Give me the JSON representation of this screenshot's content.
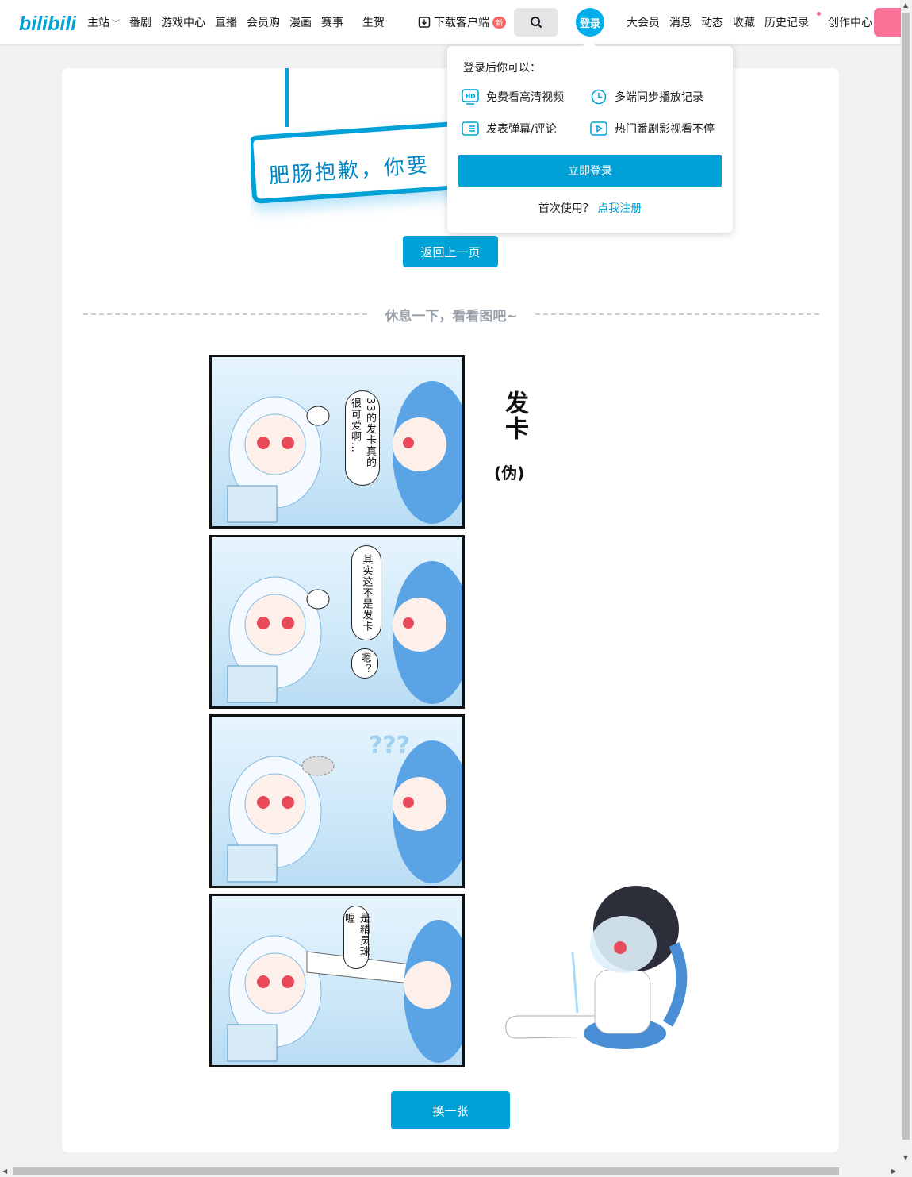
{
  "header": {
    "nav": [
      "主站",
      "番剧",
      "游戏中心",
      "直播",
      "会员购",
      "漫画",
      "赛事",
      "生贺"
    ],
    "download": "下载客户端",
    "download_badge": "新",
    "login": "登录",
    "right_nav": [
      "大会员",
      "消息",
      "动态",
      "收藏",
      "历史记录",
      "创作中心"
    ]
  },
  "error": {
    "sign_text": "肥肠抱歉，你要",
    "back_button": "返回上一页"
  },
  "divider_text": "休息一下，看看图吧~",
  "comic": {
    "title": "发卡",
    "subtitle": "(伪)",
    "bubble1": "33的发卡真的很可爱啊…",
    "bubble2": "其实这不是发卡",
    "bubble2b": "嗯？",
    "bubble4": "是精灵球喔"
  },
  "swap_button": "换一张",
  "popup": {
    "title": "登录后你可以：",
    "perks": [
      "免费看高清视频",
      "多端同步播放记录",
      "发表弹幕/评论",
      "热门番剧影视看不停"
    ],
    "login_button": "立即登录",
    "register_prompt": "首次使用？",
    "register_link": "点我注册"
  },
  "colors": {
    "brand_blue": "#00a1d6",
    "pink": "#fb7299"
  }
}
